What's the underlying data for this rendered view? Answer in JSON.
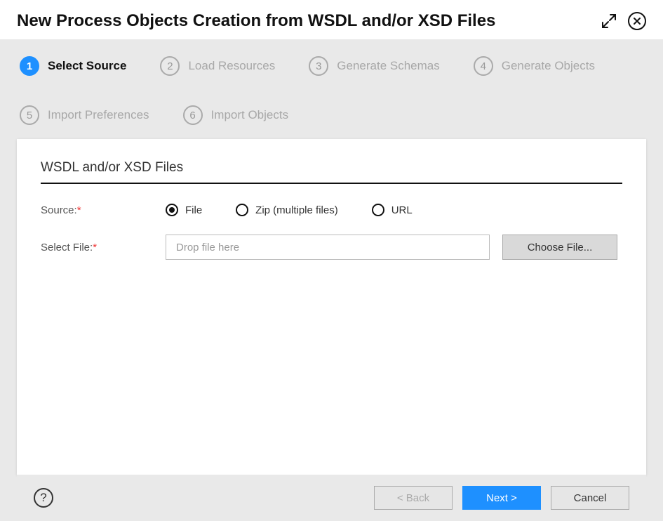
{
  "dialog": {
    "title": "New Process Objects Creation from WSDL and/or XSD Files"
  },
  "steps": [
    {
      "num": "1",
      "label": "Select Source",
      "active": true
    },
    {
      "num": "2",
      "label": "Load Resources",
      "active": false
    },
    {
      "num": "3",
      "label": "Generate Schemas",
      "active": false
    },
    {
      "num": "4",
      "label": "Generate Objects",
      "active": false
    },
    {
      "num": "5",
      "label": "Import Preferences",
      "active": false
    },
    {
      "num": "6",
      "label": "Import Objects",
      "active": false
    }
  ],
  "panel": {
    "title": "WSDL and/or XSD Files",
    "source_label": "Source:",
    "select_file_label": "Select File:",
    "required_mark": "*",
    "radios": {
      "file": "File",
      "zip": "Zip (multiple files)",
      "url": "URL",
      "selected": "file"
    },
    "drop_placeholder": "Drop file here",
    "choose_file": "Choose File..."
  },
  "footer": {
    "help": "?",
    "back": "< Back",
    "next": "Next >",
    "cancel": "Cancel"
  }
}
